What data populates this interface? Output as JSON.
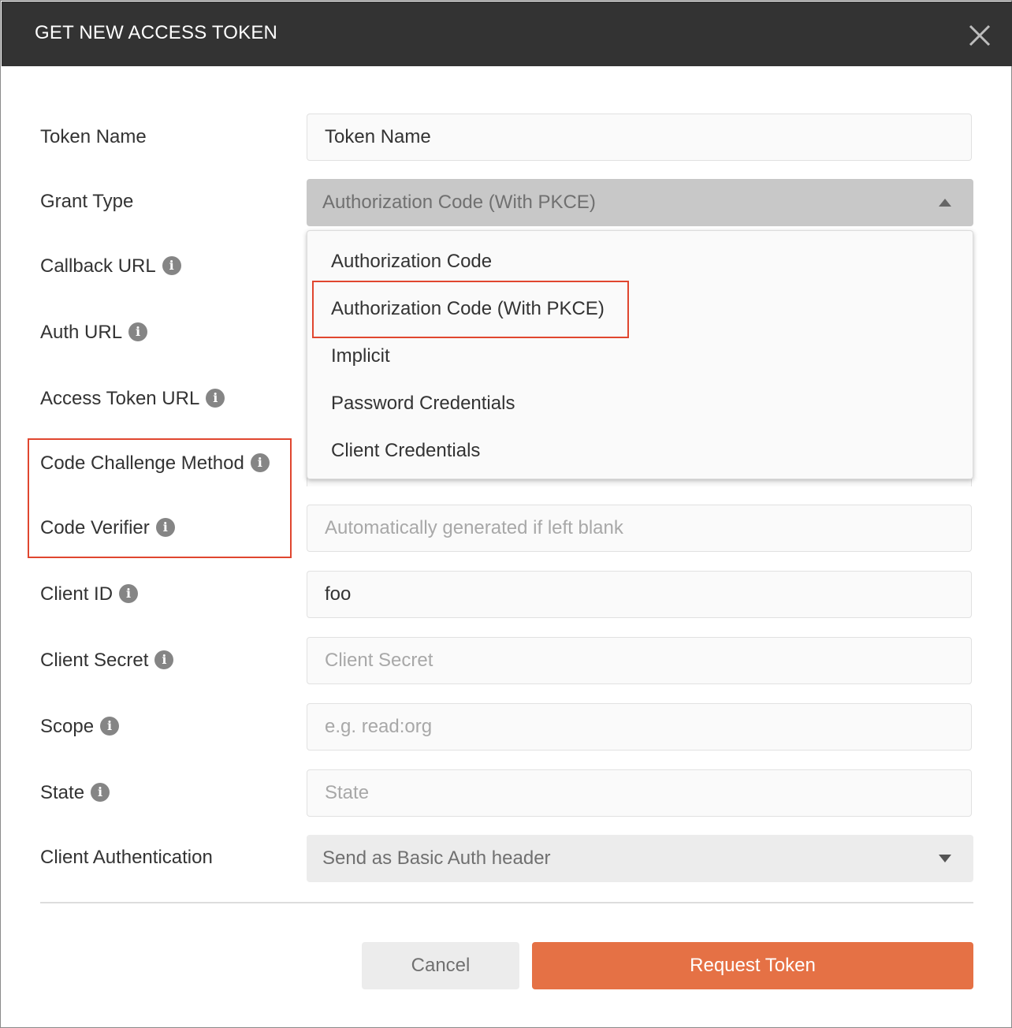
{
  "dialog": {
    "title": "GET NEW ACCESS TOKEN"
  },
  "form": {
    "token_name": {
      "label": "Token Name",
      "value": "Token Name"
    },
    "grant_type": {
      "label": "Grant Type",
      "selected": "Authorization Code (With PKCE)"
    },
    "callback_url": {
      "label": "Callback URL"
    },
    "auth_url": {
      "label": "Auth URL"
    },
    "access_token_url": {
      "label": "Access Token URL"
    },
    "code_challenge_method": {
      "label": "Code Challenge Method"
    },
    "code_verifier": {
      "label": "Code Verifier",
      "placeholder": "Automatically generated if left blank"
    },
    "client_id": {
      "label": "Client ID",
      "value": "foo"
    },
    "client_secret": {
      "label": "Client Secret",
      "placeholder": "Client Secret"
    },
    "scope": {
      "label": "Scope",
      "placeholder": "e.g. read:org"
    },
    "state": {
      "label": "State",
      "placeholder": "State"
    },
    "client_authentication": {
      "label": "Client Authentication",
      "selected": "Send as Basic Auth header"
    }
  },
  "grant_type_options": [
    "Authorization Code",
    "Authorization Code (With PKCE)",
    "Implicit",
    "Password Credentials",
    "Client Credentials"
  ],
  "info_glyph": "i",
  "buttons": {
    "cancel": "Cancel",
    "request_token": "Request Token"
  },
  "colors": {
    "header_bg": "#333333",
    "primary_button": "#e57145",
    "highlight_border": "#e0462f"
  }
}
